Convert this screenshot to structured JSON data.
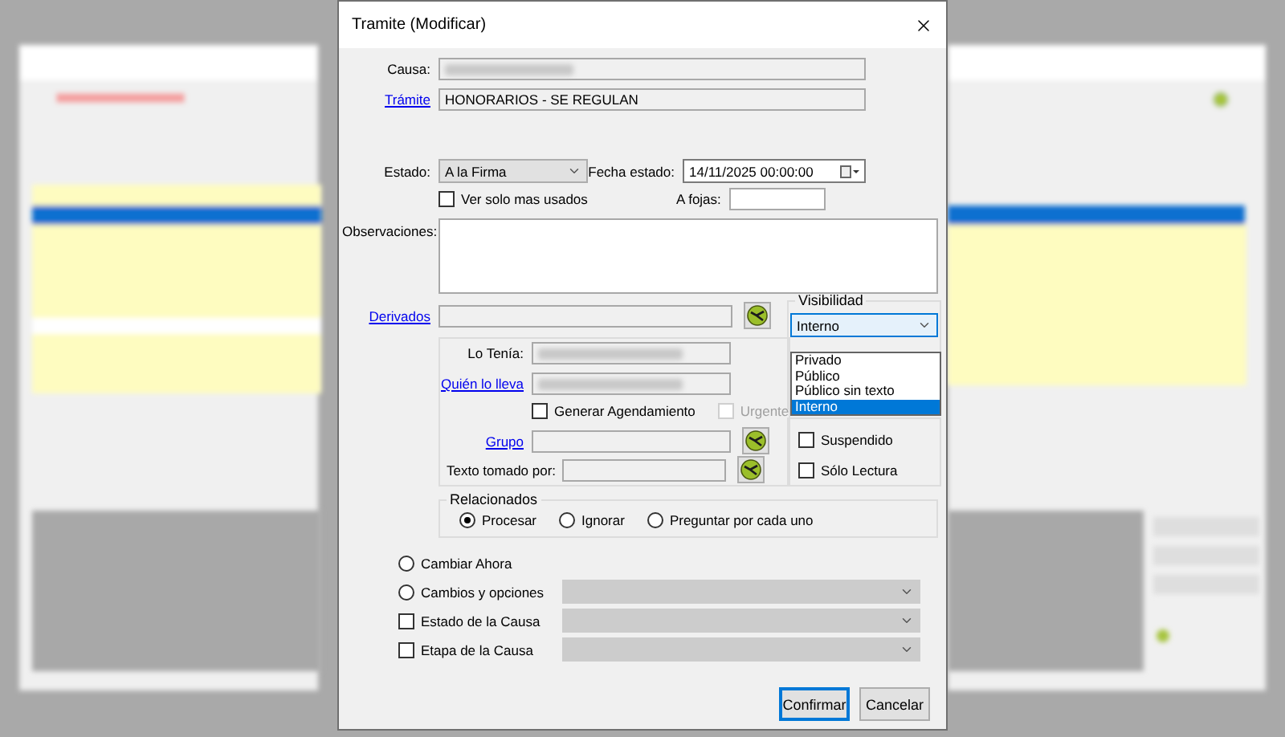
{
  "dialog": {
    "title": "Tramite  (Modificar)"
  },
  "causa": {
    "label": "Causa:"
  },
  "tramite": {
    "label": "Trámite",
    "value": "HONORARIOS - SE REGULAN"
  },
  "estado": {
    "label": "Estado:",
    "value": "A la Firma"
  },
  "fecha_estado": {
    "label": "Fecha estado:",
    "value": "14/11/2025 00:00:00"
  },
  "ver_solo_mas_usados": {
    "label": "Ver solo mas usados",
    "checked": false
  },
  "a_fojas": {
    "label": "A fojas:"
  },
  "observaciones": {
    "label": "Observaciones:"
  },
  "derivados": {
    "label": "Derivados"
  },
  "lo_tenia": {
    "label": "Lo Tenía:"
  },
  "quien_lo_lleva": {
    "label": "Quién lo lleva"
  },
  "generar_agendamiento": {
    "label": "Generar Agendamiento",
    "checked": false
  },
  "urgente": {
    "label": "Urgente",
    "checked": false,
    "disabled": true
  },
  "grupo": {
    "label": "Grupo"
  },
  "texto_tomado_por": {
    "label": "Texto tomado por:"
  },
  "visibilidad": {
    "label": "Visibilidad",
    "value": "Interno",
    "options": [
      {
        "label": "Privado",
        "selected": false
      },
      {
        "label": "Público",
        "selected": false
      },
      {
        "label": "Público sin texto",
        "selected": false
      },
      {
        "label": "Interno",
        "selected": true
      }
    ]
  },
  "flags": [
    {
      "label": "Suspendido",
      "checked": false
    },
    {
      "label": "Sólo Lectura",
      "checked": false
    }
  ],
  "relacionados": {
    "label": "Relacionados",
    "options": [
      {
        "label": "Procesar",
        "selected": true
      },
      {
        "label": "Ignorar",
        "selected": false
      },
      {
        "label": "Preguntar por cada uno",
        "selected": false
      }
    ]
  },
  "cambios": [
    {
      "kind": "radio",
      "label": "Cambiar Ahora",
      "selected": false,
      "combo": false
    },
    {
      "kind": "radio",
      "label": "Cambios y opciones",
      "selected": false,
      "combo": true
    },
    {
      "kind": "checkbox",
      "label": "Estado de la Causa",
      "checked": false,
      "combo": true
    },
    {
      "kind": "checkbox",
      "label": "Etapa de la Causa",
      "checked": false,
      "combo": true
    }
  ],
  "buttons": [
    {
      "label": "Confirmar",
      "default": true
    },
    {
      "label": "Cancelar",
      "default": false
    }
  ]
}
